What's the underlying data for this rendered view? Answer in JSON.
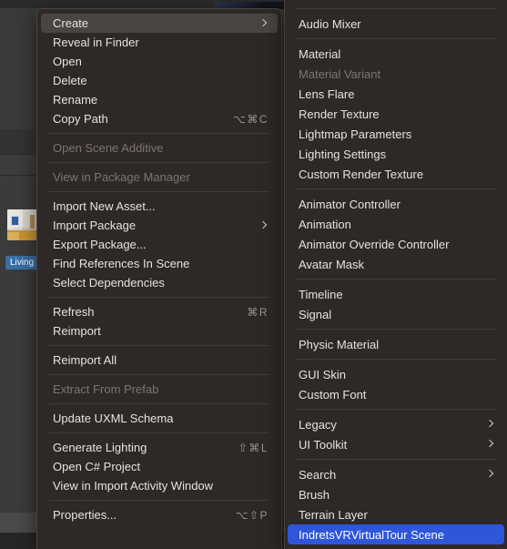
{
  "background": {
    "asset_label": "Living",
    "asset_thumbnail_name": "living-room-panorama-thumbnail"
  },
  "colors": {
    "menu_background": "#2e2926",
    "menu_border": "#4a4441",
    "menu_text": "#e6e2de",
    "menu_text_disabled": "#7c7571",
    "hover_highlight": "#4a4442",
    "selection_blue": "#2f56d9",
    "separator": "#433d3a",
    "shortcut_text": "#9a9490",
    "editor_background": "#393939",
    "project_label_blue": "#3a6ea5"
  },
  "context_menu": {
    "name": "asset-context-menu",
    "items": [
      {
        "label": "Create",
        "shortcut": "",
        "submenu": true,
        "disabled": false,
        "highlighted": true
      },
      {
        "label": "Reveal in Finder",
        "shortcut": "",
        "submenu": false,
        "disabled": false,
        "highlighted": false
      },
      {
        "label": "Open",
        "shortcut": "",
        "submenu": false,
        "disabled": false,
        "highlighted": false
      },
      {
        "label": "Delete",
        "shortcut": "",
        "submenu": false,
        "disabled": false,
        "highlighted": false
      },
      {
        "label": "Rename",
        "shortcut": "",
        "submenu": false,
        "disabled": false,
        "highlighted": false
      },
      {
        "label": "Copy Path",
        "shortcut": "⌥⌘C",
        "submenu": false,
        "disabled": false,
        "highlighted": false
      },
      {
        "separator": true
      },
      {
        "label": "Open Scene Additive",
        "shortcut": "",
        "submenu": false,
        "disabled": true,
        "highlighted": false
      },
      {
        "separator": true
      },
      {
        "label": "View in Package Manager",
        "shortcut": "",
        "submenu": false,
        "disabled": true,
        "highlighted": false
      },
      {
        "separator": true
      },
      {
        "label": "Import New Asset...",
        "shortcut": "",
        "submenu": false,
        "disabled": false,
        "highlighted": false
      },
      {
        "label": "Import Package",
        "shortcut": "",
        "submenu": true,
        "disabled": false,
        "highlighted": false
      },
      {
        "label": "Export Package...",
        "shortcut": "",
        "submenu": false,
        "disabled": false,
        "highlighted": false
      },
      {
        "label": "Find References In Scene",
        "shortcut": "",
        "submenu": false,
        "disabled": false,
        "highlighted": false
      },
      {
        "label": "Select Dependencies",
        "shortcut": "",
        "submenu": false,
        "disabled": false,
        "highlighted": false
      },
      {
        "separator": true
      },
      {
        "label": "Refresh",
        "shortcut": "⌘R",
        "submenu": false,
        "disabled": false,
        "highlighted": false
      },
      {
        "label": "Reimport",
        "shortcut": "",
        "submenu": false,
        "disabled": false,
        "highlighted": false
      },
      {
        "separator": true
      },
      {
        "label": "Reimport All",
        "shortcut": "",
        "submenu": false,
        "disabled": false,
        "highlighted": false
      },
      {
        "separator": true
      },
      {
        "label": "Extract From Prefab",
        "shortcut": "",
        "submenu": false,
        "disabled": true,
        "highlighted": false
      },
      {
        "separator": true
      },
      {
        "label": "Update UXML Schema",
        "shortcut": "",
        "submenu": false,
        "disabled": false,
        "highlighted": false
      },
      {
        "separator": true
      },
      {
        "label": "Generate Lighting",
        "shortcut": "⇧⌘L",
        "submenu": false,
        "disabled": false,
        "highlighted": false
      },
      {
        "label": "Open C# Project",
        "shortcut": "",
        "submenu": false,
        "disabled": false,
        "highlighted": false
      },
      {
        "label": "View in Import Activity Window",
        "shortcut": "",
        "submenu": false,
        "disabled": false,
        "highlighted": false
      },
      {
        "separator": true
      },
      {
        "label": "Properties...",
        "shortcut": "⌥⇧P",
        "submenu": false,
        "disabled": false,
        "highlighted": false
      }
    ]
  },
  "create_submenu": {
    "name": "create-submenu",
    "items": [
      {
        "separator": true
      },
      {
        "label": "Audio Mixer",
        "submenu": false,
        "disabled": false,
        "selected": false
      },
      {
        "separator": true
      },
      {
        "label": "Material",
        "submenu": false,
        "disabled": false,
        "selected": false
      },
      {
        "label": "Material Variant",
        "submenu": false,
        "disabled": true,
        "selected": false
      },
      {
        "label": "Lens Flare",
        "submenu": false,
        "disabled": false,
        "selected": false
      },
      {
        "label": "Render Texture",
        "submenu": false,
        "disabled": false,
        "selected": false
      },
      {
        "label": "Lightmap Parameters",
        "submenu": false,
        "disabled": false,
        "selected": false
      },
      {
        "label": "Lighting Settings",
        "submenu": false,
        "disabled": false,
        "selected": false
      },
      {
        "label": "Custom Render Texture",
        "submenu": false,
        "disabled": false,
        "selected": false
      },
      {
        "separator": true
      },
      {
        "label": "Animator Controller",
        "submenu": false,
        "disabled": false,
        "selected": false
      },
      {
        "label": "Animation",
        "submenu": false,
        "disabled": false,
        "selected": false
      },
      {
        "label": "Animator Override Controller",
        "submenu": false,
        "disabled": false,
        "selected": false
      },
      {
        "label": "Avatar Mask",
        "submenu": false,
        "disabled": false,
        "selected": false
      },
      {
        "separator": true
      },
      {
        "label": "Timeline",
        "submenu": false,
        "disabled": false,
        "selected": false
      },
      {
        "label": "Signal",
        "submenu": false,
        "disabled": false,
        "selected": false
      },
      {
        "separator": true
      },
      {
        "label": "Physic Material",
        "submenu": false,
        "disabled": false,
        "selected": false
      },
      {
        "separator": true
      },
      {
        "label": "GUI Skin",
        "submenu": false,
        "disabled": false,
        "selected": false
      },
      {
        "label": "Custom Font",
        "submenu": false,
        "disabled": false,
        "selected": false
      },
      {
        "separator": true
      },
      {
        "label": "Legacy",
        "submenu": true,
        "disabled": false,
        "selected": false
      },
      {
        "label": "UI Toolkit",
        "submenu": true,
        "disabled": false,
        "selected": false
      },
      {
        "separator": true
      },
      {
        "label": "Search",
        "submenu": true,
        "disabled": false,
        "selected": false
      },
      {
        "label": "Brush",
        "submenu": false,
        "disabled": false,
        "selected": false
      },
      {
        "label": "Terrain Layer",
        "submenu": false,
        "disabled": false,
        "selected": false
      },
      {
        "label": "IndretsVRVirtualTour Scene",
        "submenu": false,
        "disabled": false,
        "selected": true
      }
    ]
  }
}
